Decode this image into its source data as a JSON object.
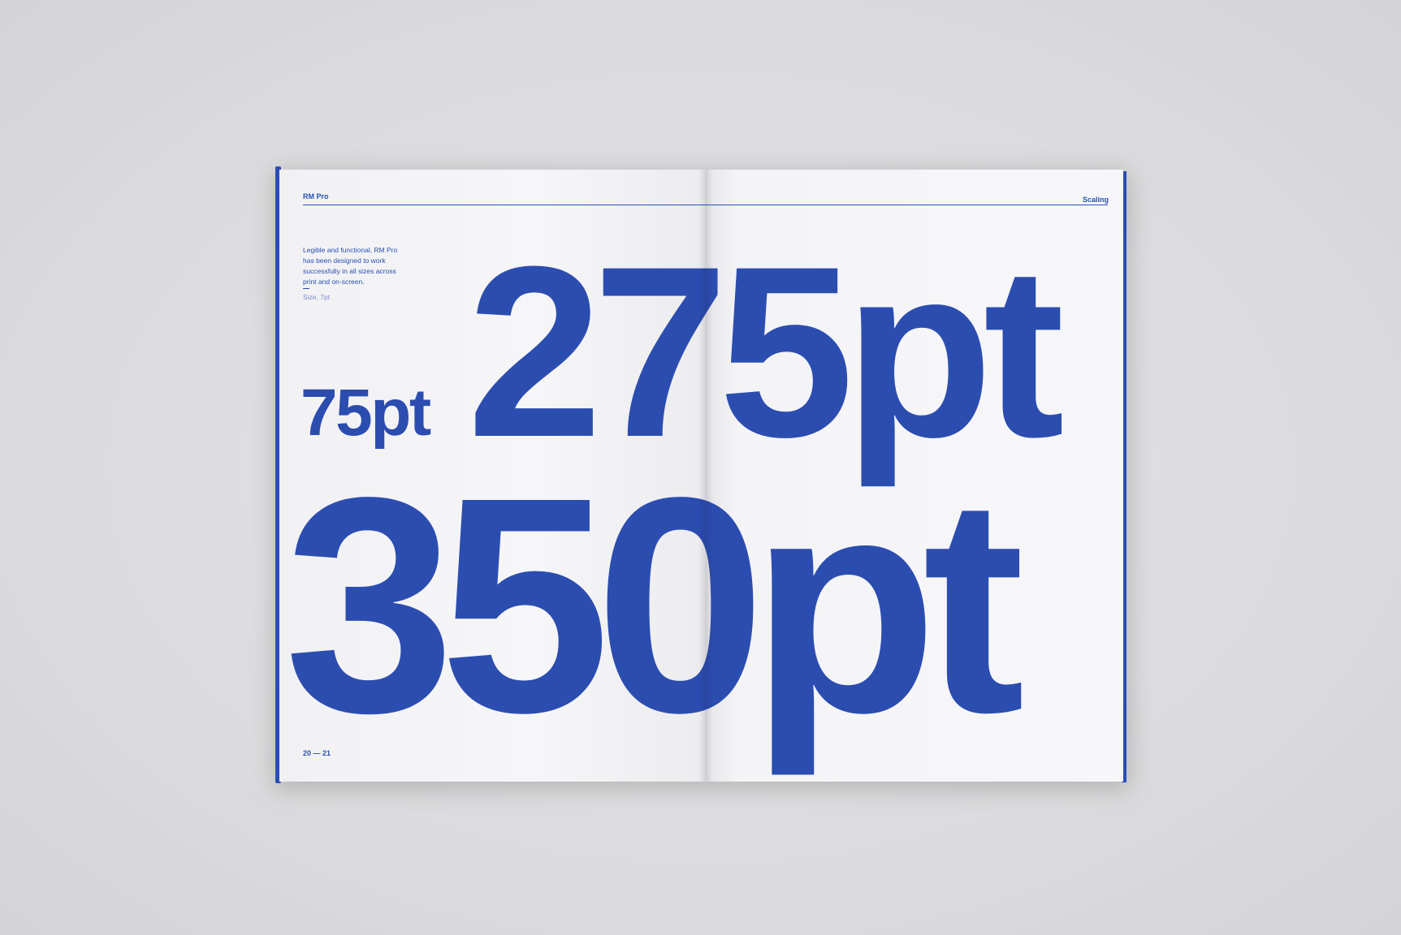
{
  "booklet": {
    "header_left": "RM Pro",
    "header_right": "Scaling",
    "blurb": "Legible and functional, RM Pro has been designed to work successfully in all sizes across print and on-screen.",
    "size_note": "Size, 7pt",
    "folio": "20 — 21",
    "specimens": [
      "75pt",
      "275pt",
      "350pt"
    ]
  },
  "colors": {
    "type_blue": "#2c4db0",
    "background": "#dcdcde",
    "paper": "#f5f5f7"
  }
}
